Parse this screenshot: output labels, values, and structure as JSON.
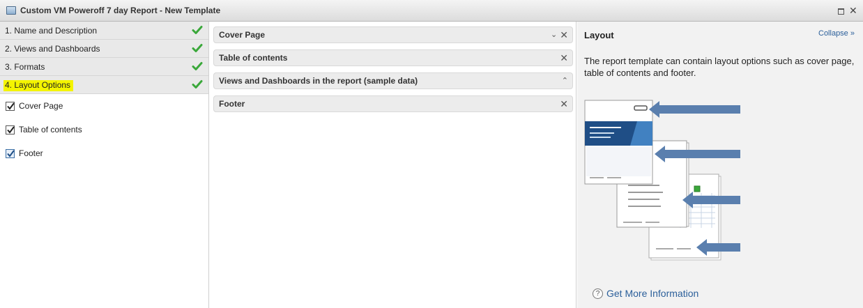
{
  "window": {
    "title": "Custom VM Poweroff 7 day Report - New Template",
    "controls": [
      "restore-icon",
      "close-icon"
    ]
  },
  "steps": [
    {
      "label": "1. Name and Description",
      "completed": true
    },
    {
      "label": "2. Views and Dashboards",
      "completed": true
    },
    {
      "label": "3. Formats",
      "completed": true
    },
    {
      "label": "4. Layout Options",
      "completed": true,
      "active": true
    }
  ],
  "layout_options": [
    {
      "label": "Cover Page",
      "checked": true
    },
    {
      "label": "Table of contents",
      "checked": true
    },
    {
      "label": "Footer",
      "checked": true
    }
  ],
  "sections": [
    {
      "title": "Cover Page",
      "buttons": [
        "move-down-icon",
        "close-icon"
      ]
    },
    {
      "title": "Table of contents",
      "buttons": [
        "close-icon"
      ]
    },
    {
      "title": "Views and Dashboards in the report (sample data)",
      "buttons": [
        "move-up-icon"
      ]
    },
    {
      "title": "Footer",
      "buttons": [
        "close-icon"
      ]
    }
  ],
  "help_panel": {
    "title": "Layout",
    "collapse_label": "Collapse",
    "description": "The report template can contain layout options such as cover page, table of contents and footer.",
    "more_info_label": "Get More Information"
  },
  "colors": {
    "check_green": "#3aa83a",
    "link_blue": "#2b5f9a",
    "highlight_yellow": "#f4f400",
    "arrow_blue": "#5a7fae"
  }
}
